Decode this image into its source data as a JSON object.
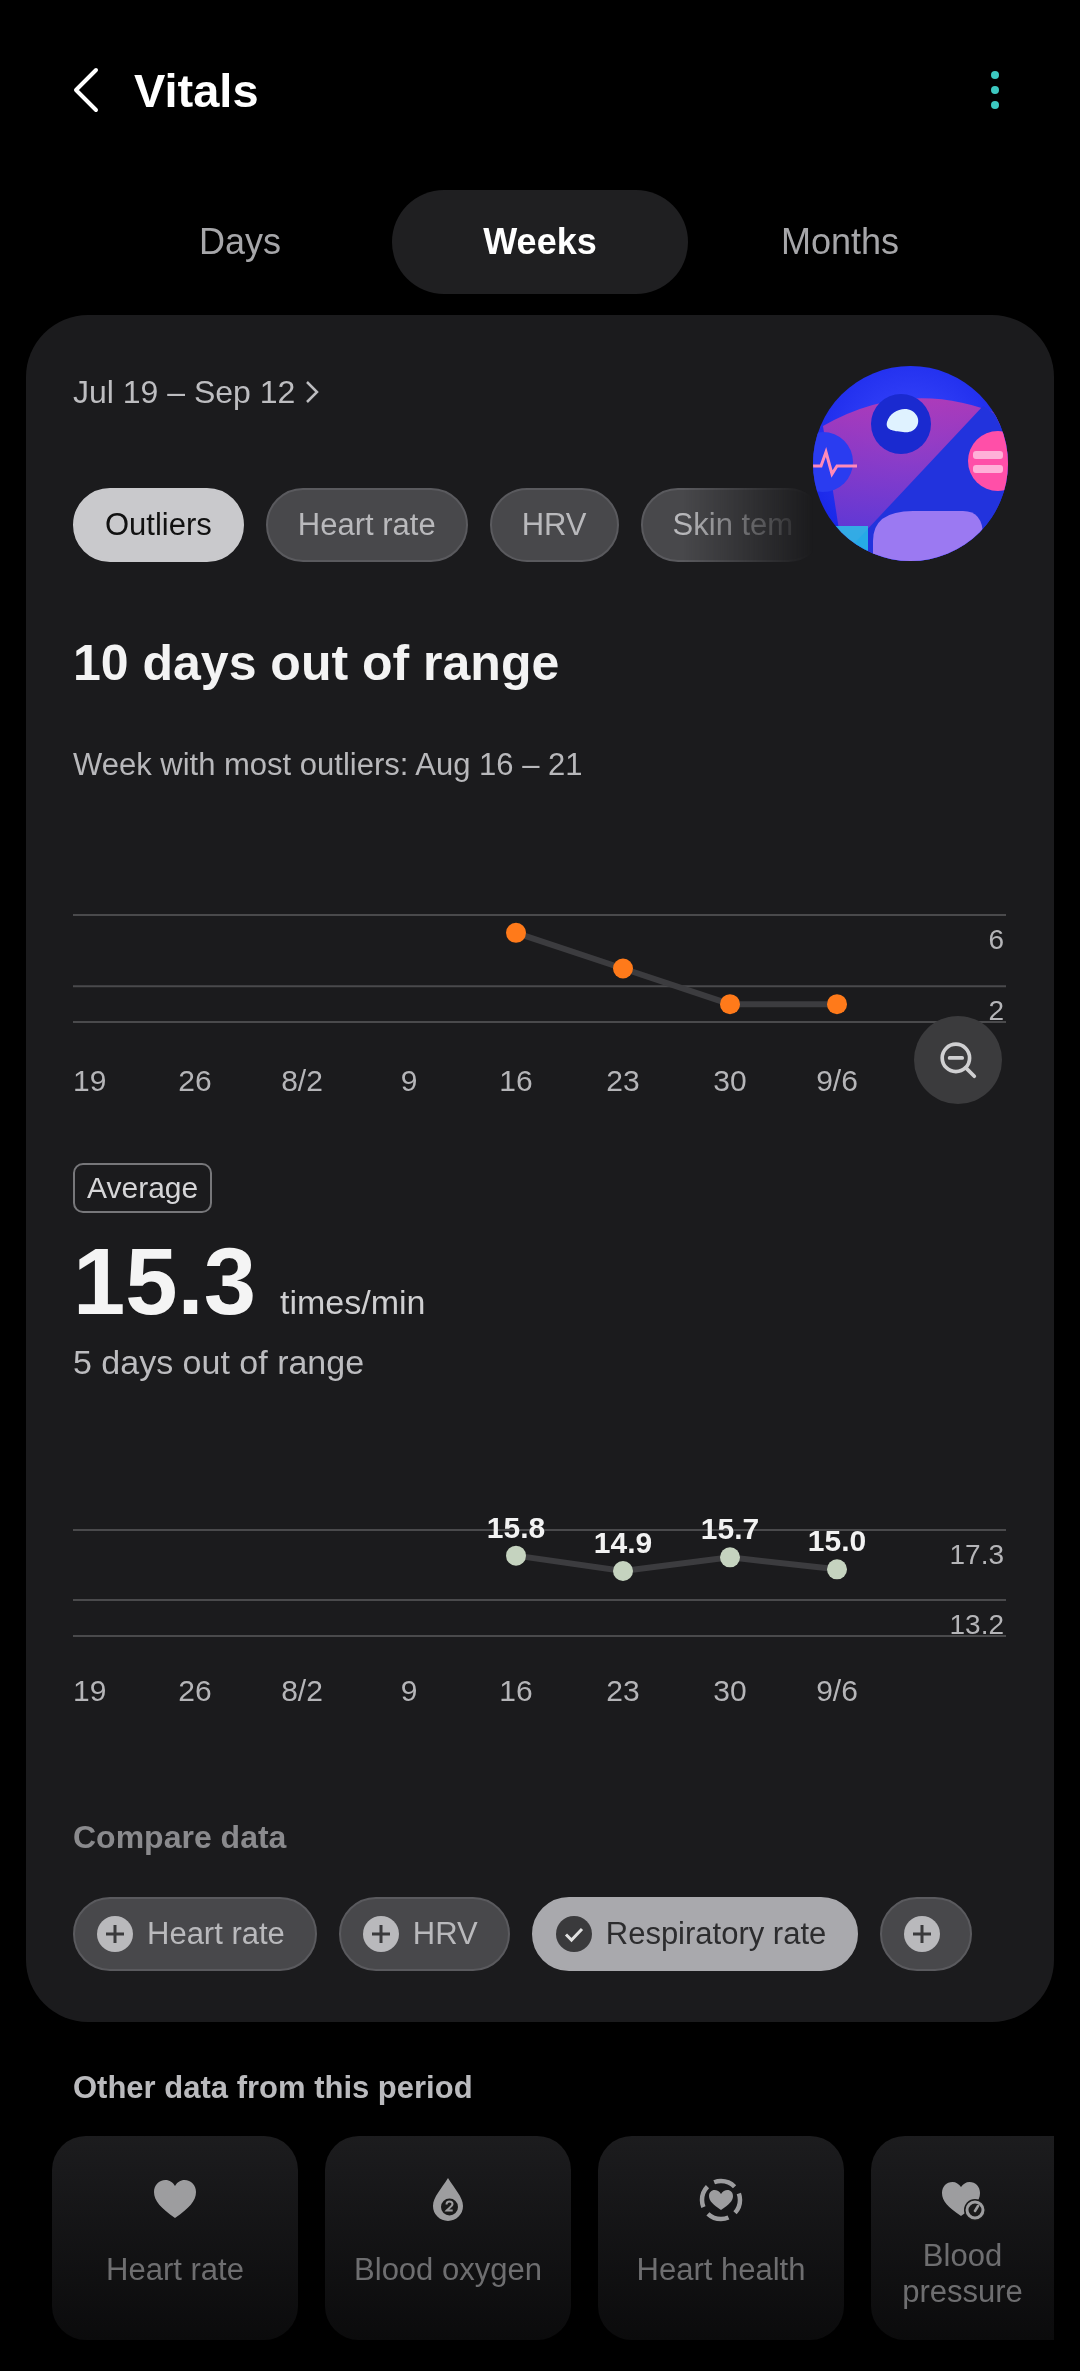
{
  "header": {
    "title": "Vitals"
  },
  "tabs": [
    {
      "label": "Days",
      "selected": false
    },
    {
      "label": "Weeks",
      "selected": true
    },
    {
      "label": "Months",
      "selected": false
    }
  ],
  "period": "Jul 19 – Sep 12",
  "filters": [
    {
      "label": "Outliers",
      "selected": true
    },
    {
      "label": "Heart rate",
      "selected": false
    },
    {
      "label": "HRV",
      "selected": false
    },
    {
      "label": "Skin tem",
      "selected": false
    }
  ],
  "summary": {
    "title": "10 days out of range",
    "subtitle": "Week with most outliers: Aug 16 – 21"
  },
  "outliers_chart": {
    "chart_data": {
      "type": "line",
      "categories": [
        "19",
        "26",
        "8/2",
        "9",
        "16",
        "23",
        "30",
        "9/6"
      ],
      "series": [
        {
          "color": "#ff7a1a",
          "marker": "circle",
          "values": [
            null,
            null,
            null,
            null,
            5,
            3,
            1,
            1
          ]
        }
      ],
      "ylim": [
        0,
        6
      ],
      "yticks": [
        2,
        6
      ]
    }
  },
  "average": {
    "badge": "Average",
    "value": "15.3",
    "unit": "times/min",
    "note": "5 days out of range",
    "chart_data": {
      "type": "line",
      "categories": [
        "19",
        "26",
        "8/2",
        "9",
        "16",
        "23",
        "30",
        "9/6"
      ],
      "series": [
        {
          "color": "#c5d3bf",
          "marker": "circle",
          "values": [
            null,
            null,
            null,
            null,
            15.8,
            14.9,
            15.7,
            15.0
          ]
        }
      ],
      "ylim": [
        11.1,
        17.3
      ],
      "yticks": [
        13.2,
        17.3
      ],
      "value_labels": [
        null,
        null,
        null,
        null,
        "15.8",
        "14.9",
        "15.7",
        "15.0"
      ]
    }
  },
  "compare": {
    "title": "Compare data",
    "chips": [
      {
        "label": "Heart rate",
        "selected": false
      },
      {
        "label": "HRV",
        "selected": false
      },
      {
        "label": "Respiratory rate",
        "selected": true
      },
      {
        "selected": false
      }
    ]
  },
  "other": {
    "title": "Other data from this period",
    "tiles": [
      {
        "kind": "heart",
        "label": "Heart rate"
      },
      {
        "kind": "drop",
        "label": "Blood oxygen"
      },
      {
        "kind": "ring-heart",
        "label": "Heart health"
      },
      {
        "kind": "gauge-heart",
        "label": "Blood pressure"
      }
    ]
  }
}
